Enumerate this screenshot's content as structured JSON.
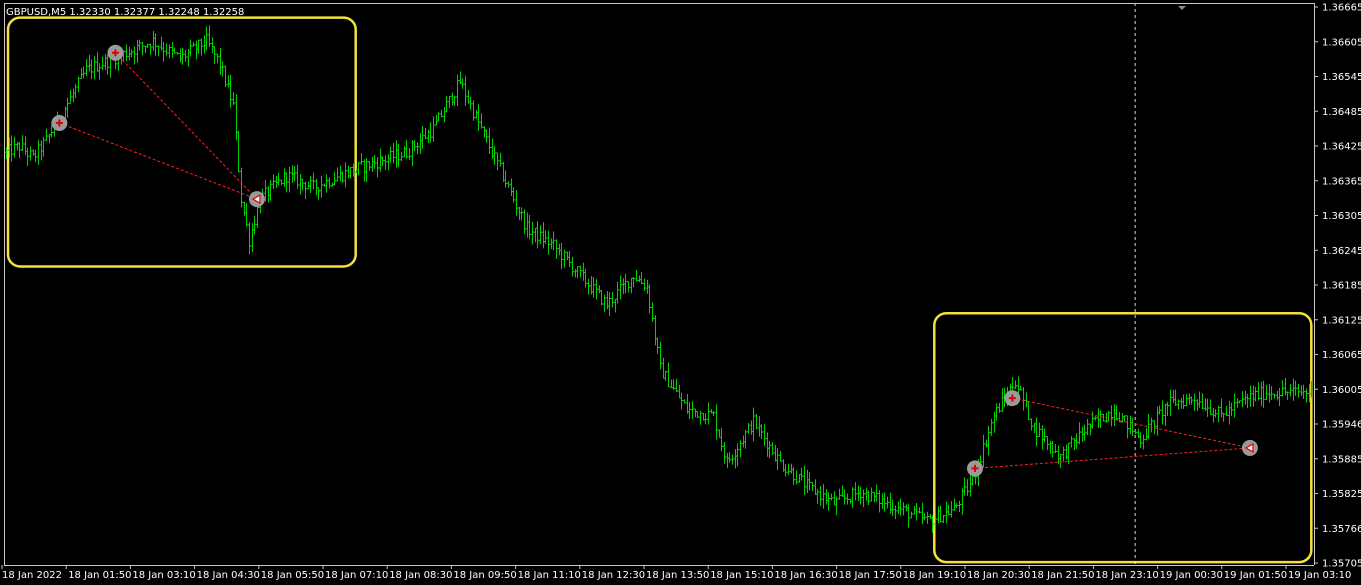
{
  "header": {
    "symbol": "GBPUSD,M5",
    "ohlc": "1.32330 1.32377 1.32248 1.32258"
  },
  "colors": {
    "background": "#000000",
    "bar": "#00d000",
    "axis": "#c8c8c8",
    "text": "#ffffff",
    "highlight_box": "#f2e23a",
    "trade_line": "#ff2020",
    "marker_fill": "#9a9a9a",
    "crosshair": "#ffffff"
  },
  "chart_data": {
    "type": "ohlc",
    "title": "GBPUSD,M5  1.32330 1.32377 1.32248 1.32258",
    "ylim": [
      1.35705,
      1.36665
    ],
    "y_ticks": [
      "1.36665",
      "1.36605",
      "1.36545",
      "1.36485",
      "1.36425",
      "1.36365",
      "1.36305",
      "1.36245",
      "1.36185",
      "1.36125",
      "1.36065",
      "1.36005",
      "1.35946",
      "1.35885",
      "1.35825",
      "1.35766",
      "1.35705"
    ],
    "x_ticks": [
      "18 Jan 2022",
      "18 Jan 01:50",
      "18 Jan 03:10",
      "18 Jan 04:30",
      "18 Jan 05:50",
      "18 Jan 07:10",
      "18 Jan 08:30",
      "18 Jan 09:50",
      "18 Jan 11:10",
      "18 Jan 12:30",
      "18 Jan 13:50",
      "18 Jan 15:10",
      "18 Jan 16:30",
      "18 Jan 17:50",
      "18 Jan 19:10",
      "18 Jan 20:30",
      "18 Jan 21:50",
      "18 Jan 23:10",
      "19 Jan 00:30",
      "19 Jan 01:50",
      "19 Jan 03:10"
    ],
    "price_path_anchors": [
      [
        0,
        1.3641
      ],
      [
        5,
        1.3642
      ],
      [
        10,
        1.364
      ],
      [
        15,
        1.3643
      ],
      [
        20,
        1.3647
      ],
      [
        30,
        1.3655
      ],
      [
        45,
        1.3658
      ],
      [
        55,
        1.366
      ],
      [
        65,
        1.3657
      ],
      [
        75,
        1.366
      ],
      [
        80,
        1.3656
      ],
      [
        85,
        1.3649
      ],
      [
        88,
        1.3633
      ],
      [
        91,
        1.3626
      ],
      [
        95,
        1.3633
      ],
      [
        105,
        1.3637
      ],
      [
        115,
        1.3635
      ],
      [
        130,
        1.3638
      ],
      [
        150,
        1.3641
      ],
      [
        160,
        1.3645
      ],
      [
        170,
        1.3653
      ],
      [
        178,
        1.3645
      ],
      [
        185,
        1.3638
      ],
      [
        195,
        1.3628
      ],
      [
        205,
        1.3625
      ],
      [
        215,
        1.362
      ],
      [
        225,
        1.3615
      ],
      [
        235,
        1.362
      ],
      [
        240,
        1.3618
      ],
      [
        245,
        1.3604
      ],
      [
        255,
        1.3597
      ],
      [
        265,
        1.3596
      ],
      [
        270,
        1.3588
      ],
      [
        280,
        1.3595
      ],
      [
        290,
        1.3588
      ],
      [
        300,
        1.3584
      ],
      [
        310,
        1.3581
      ],
      [
        320,
        1.3583
      ],
      [
        335,
        1.358
      ],
      [
        345,
        1.3578
      ],
      [
        355,
        1.358
      ],
      [
        362,
        1.3585
      ],
      [
        370,
        1.3596
      ],
      [
        378,
        1.3602
      ],
      [
        385,
        1.3594
      ],
      [
        395,
        1.3589
      ],
      [
        405,
        1.3594
      ],
      [
        415,
        1.3597
      ],
      [
        425,
        1.3592
      ],
      [
        435,
        1.3598
      ],
      [
        445,
        1.3599
      ],
      [
        455,
        1.3596
      ],
      [
        465,
        1.3599
      ],
      [
        472,
        1.36
      ]
    ],
    "trades": [
      {
        "type": "buy",
        "from_bar": 20,
        "from_price": 1.3646,
        "to_bar": 94,
        "to_price": 1.3633
      },
      {
        "type": "buy",
        "from_bar": 41,
        "from_price": 1.3658,
        "to_bar": 94,
        "to_price": 1.3633
      },
      {
        "type": "buy",
        "from_bar": 363,
        "from_price": 1.3587,
        "to_bar": 466,
        "to_price": 1.35905
      },
      {
        "type": "buy",
        "from_bar": 377,
        "from_price": 1.3599,
        "to_bar": 466,
        "to_price": 1.35905
      }
    ],
    "highlight_boxes": [
      {
        "from_bar": 0,
        "to_bar": 131,
        "top": 1.3664,
        "bottom": 1.36215
      },
      {
        "from_bar": 347,
        "to_bar": 489,
        "top": 1.36135,
        "bottom": 1.3571
      }
    ],
    "crosshair_bar": 423,
    "bar_count": 490
  }
}
